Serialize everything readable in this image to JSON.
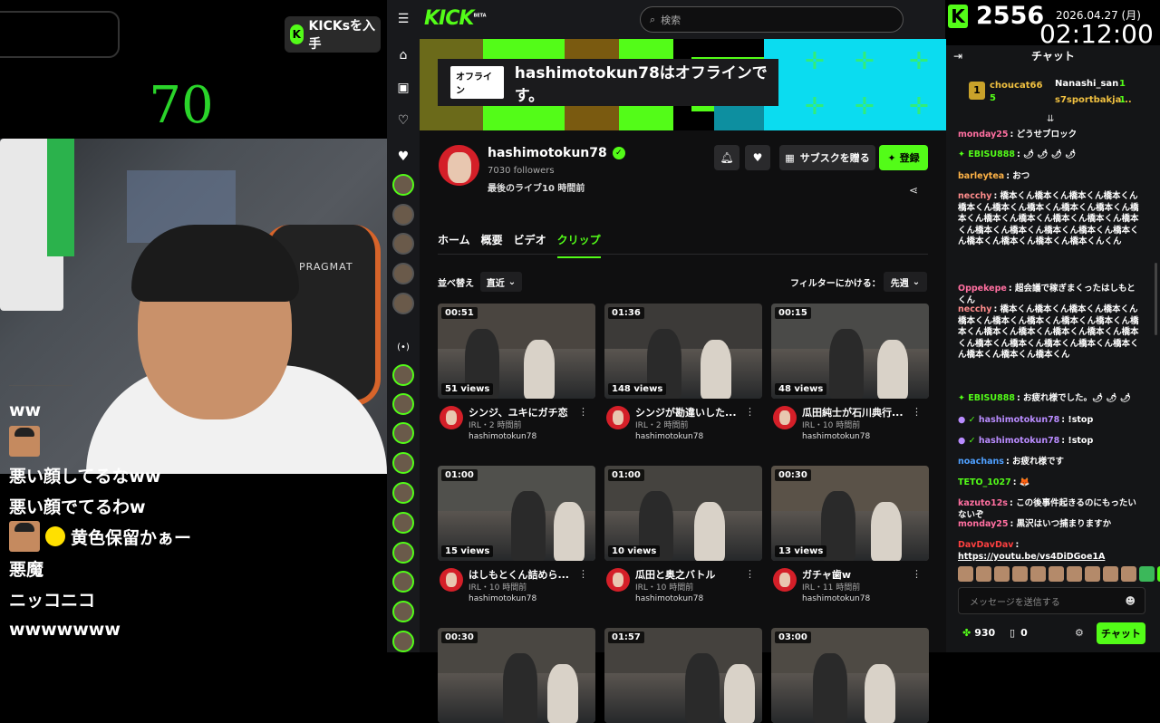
{
  "overlay": {
    "kicks_button": "KICKsを入手",
    "counter": "70",
    "comments": [
      {
        "text": "ww",
        "avatar": false,
        "dot": false
      },
      {
        "text": "悪い顔してるなww",
        "avatar": true,
        "dot": false
      },
      {
        "text": "悪い顔でてるわw",
        "avatar": false,
        "dot": false
      },
      {
        "text": "黄色保留かぁー",
        "avatar": true,
        "dot": true
      },
      {
        "text": "悪魔",
        "avatar": false,
        "dot": false
      },
      {
        "text": "ニッコニコ",
        "avatar": false,
        "dot": false
      },
      {
        "text": "wwwwwww",
        "avatar": false,
        "dot": false
      }
    ],
    "chair_label": "PRAGMAT"
  },
  "header": {
    "logo": "KICK",
    "logo_badge": "BETA",
    "search_placeholder": "検索"
  },
  "banner": {
    "offline_tag": "オフライン",
    "offline_message": "hashimotokun78はオフラインです。"
  },
  "channel": {
    "name": "hashimotokun78",
    "followers": "7030 followers",
    "last_live": "最後のライブ10 時間前",
    "gift_label": "サブスクを贈る",
    "subscribe_label": "登録",
    "tabs": [
      "ホーム",
      "概要",
      "ビデオ",
      "クリップ"
    ],
    "active_tab": 3,
    "sort_label": "並べ替え",
    "sort_value": "直近",
    "filter_label": "フィルターにかける：",
    "filter_value": "先週"
  },
  "clips": [
    {
      "duration": "00:51",
      "views": "51 views",
      "title": "シンジ、ユキにガチ恋",
      "meta": "IRL・2 時間前",
      "user": "hashimotokun78",
      "hue": "#4a4540"
    },
    {
      "duration": "01:36",
      "views": "148 views",
      "title": "シンジが勘違いした...",
      "meta": "IRL・2 時間前",
      "user": "hashimotokun78",
      "hue": "#3c3a38"
    },
    {
      "duration": "00:15",
      "views": "48 views",
      "title": "瓜田純士が石川典行...",
      "meta": "IRL・10 時間前",
      "user": "hashimotokun78",
      "hue": "#4a4a48"
    },
    {
      "duration": "01:00",
      "views": "15 views",
      "title": "はしもとくん詰めら...",
      "meta": "IRL・10 時間前",
      "user": "hashimotokun78",
      "hue": "#50504c"
    },
    {
      "duration": "01:00",
      "views": "10 views",
      "title": "瓜田と奥之バトル",
      "meta": "IRL・10 時間前",
      "user": "hashimotokun78",
      "hue": "#45433f"
    },
    {
      "duration": "00:30",
      "views": "13 views",
      "title": "ガチャ歯w",
      "meta": "IRL・11 時間前",
      "user": "hashimotokun78",
      "hue": "#5a5248"
    },
    {
      "duration": "00:30",
      "views": "",
      "title": "",
      "meta": "",
      "user": "",
      "hue": "#4a4742"
    },
    {
      "duration": "01:57",
      "views": "",
      "title": "",
      "meta": "",
      "user": "",
      "hue": "#45423e"
    },
    {
      "duration": "03:00",
      "views": "",
      "title": "",
      "meta": "",
      "user": "",
      "hue": "#4e4a44"
    }
  ],
  "stream_stats": {
    "kick_count": "2556",
    "date": "2026.04.27 (月)",
    "time": "02:12:00"
  },
  "chat": {
    "title": "チャット",
    "pinned": [
      {
        "rank": "1",
        "name": "choucat66",
        "amount": "5",
        "color": "#f0c040"
      },
      {
        "rank": "",
        "name": "Nanashi_san",
        "amount": "1",
        "color": "#ffffff"
      },
      {
        "rank": "",
        "name": "s7sportbakja...",
        "amount": "1",
        "color": "#f0c040"
      }
    ],
    "messages": [
      {
        "user": "monday25",
        "color": "#ff6fa0",
        "text": "どうせブロック"
      },
      {
        "user": "EBISU888",
        "color": "#53fc18",
        "text": "🌶 🌶 🌶 🌶"
      },
      {
        "user": "barleytea",
        "color": "#ffb347",
        "text": "おつ"
      },
      {
        "user": "necchy",
        "color": "#ff8c8c",
        "text": "橋本くん橋本くん橋本くん橋本くん橋本くん橋本くん橋本くん橋本くん橋本くん橋本くん橋本くん橋本くん橋本くん橋本くん橋本くん橋本くん橋本くん橋本くん橋本くん橋本くん橋本くん橋本くん橋本くん橋本くんくん"
      },
      {
        "user": "Oppekepe",
        "color": "#ff6fa0",
        "text": "超会議で稼ぎまくったはしもとくん"
      },
      {
        "user": "necchy",
        "color": "#ff8c8c",
        "text": "橋本くん橋本くん橋本くん橋本くん橋本くん橋本くん橋本くん橋本くん橋本くん橋本くん橋本くん橋本くん橋本くん橋本くん橋本くん橋本くん橋本くん橋本くん橋本くん橋本くん橋本くん橋本くん橋本くん"
      },
      {
        "user": "EBISU888",
        "color": "#53fc18",
        "text": "お疲れ様でした。🌶 🌶 🌶"
      },
      {
        "user": "hashimotokun78",
        "color": "#b98cff",
        "text": "!stop"
      },
      {
        "user": "hashimotokun78",
        "color": "#b98cff",
        "text": "!stop"
      },
      {
        "user": "noachans",
        "color": "#4fa0ff",
        "text": "お疲れ様です"
      },
      {
        "user": "TETO_1027",
        "color": "#53fc18",
        "text": "🦊"
      },
      {
        "user": "kazuto12s",
        "color": "#ff6fa0",
        "text": "この後事件起きるのにもったいないぞ"
      },
      {
        "user": "monday25",
        "color": "#ff6fa0",
        "text": "黒沢はいつ捕まりますか"
      },
      {
        "user": "DavDavDav",
        "color": "#ff4040",
        "text": "https://youtu.be/vs4DiDGoe1A"
      }
    ],
    "input_placeholder": "メッセージを送信する",
    "points": "930",
    "kicks": "0",
    "send_label": "チャット"
  }
}
